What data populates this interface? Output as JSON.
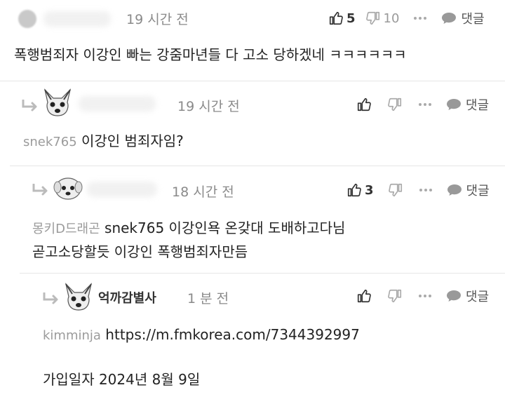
{
  "comments": [
    {
      "time": "19 시간 전",
      "likes": "5",
      "dislikes": "10",
      "reply_label": "댓글",
      "text": "폭행범죄자 이강인 빠는 강줌마년들 다 고소 당하겠네 ㅋㅋㅋㅋㅋㅋ"
    },
    {
      "time": "19 시간 전",
      "reply_label": "댓글",
      "mention": "snek765",
      "text": "이강인 범죄자임?"
    },
    {
      "time": "18 시간 전",
      "likes": "3",
      "reply_label": "댓글",
      "mention": "몽키D드래곤",
      "text_line1": "snek765 이강인욕 온갖대 도배하고다님",
      "text_line2": "곧고소당할듯 이강인 폭행범죄자만듬"
    },
    {
      "nickname": "억까감별사",
      "time": "1 분 전",
      "reply_label": "댓글",
      "mention": "kimminja",
      "link": "https://m.fmkorea.com/7344392997",
      "text2": "가입일자 2024년 8월 9일"
    }
  ],
  "icons": [
    "thumbs-up-icon",
    "thumbs-down-icon",
    "more-icon",
    "speech-bubble-icon",
    "reply-arrow-icon",
    "dog-avatar"
  ],
  "colors": {
    "text": "#222222",
    "muted": "#8a8a8a",
    "mention": "#9b9b9b",
    "separator": "#e6e6e6"
  }
}
